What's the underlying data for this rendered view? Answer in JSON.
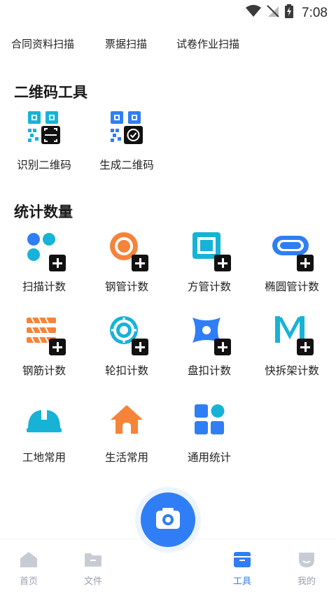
{
  "status": {
    "time": "7:08"
  },
  "top_links": [
    "合同资料扫描",
    "票据扫描",
    "试卷作业扫描"
  ],
  "qr_section": {
    "title": "二维码工具",
    "items": [
      {
        "label": "识别二维码",
        "icon": "qr-scan-icon"
      },
      {
        "label": "生成二维码",
        "icon": "qr-generate-icon"
      }
    ]
  },
  "count_section": {
    "title": "统计数量",
    "items": [
      {
        "label": "扫描计数",
        "icon": "scan-count-icon"
      },
      {
        "label": "钢管计数",
        "icon": "steel-pipe-count-icon"
      },
      {
        "label": "方管计数",
        "icon": "square-pipe-count-icon"
      },
      {
        "label": "椭圆管计数",
        "icon": "oval-pipe-count-icon"
      },
      {
        "label": "钢筋计数",
        "icon": "rebar-count-icon"
      },
      {
        "label": "轮扣计数",
        "icon": "wheel-buckle-count-icon"
      },
      {
        "label": "盘扣计数",
        "icon": "disc-buckle-count-icon"
      },
      {
        "label": "快拆架计数",
        "icon": "quick-scaffold-count-icon"
      },
      {
        "label": "工地常用",
        "icon": "hard-hat-icon"
      },
      {
        "label": "生活常用",
        "icon": "house-icon"
      },
      {
        "label": "通用统计",
        "icon": "grid-apps-icon"
      }
    ]
  },
  "bottom_nav": {
    "items": [
      {
        "label": "首页",
        "icon": "home-icon",
        "active": false
      },
      {
        "label": "文件",
        "icon": "folder-icon",
        "active": false
      },
      {
        "label": "工具",
        "icon": "toolbox-icon",
        "active": true
      },
      {
        "label": "我的",
        "icon": "profile-icon",
        "active": false
      }
    ],
    "camera_icon": "camera-icon"
  },
  "colors": {
    "accent": "#2f7ef5",
    "cyan": "#17b3d6",
    "orange": "#f5833a",
    "inactive": "#9aa0ab"
  }
}
